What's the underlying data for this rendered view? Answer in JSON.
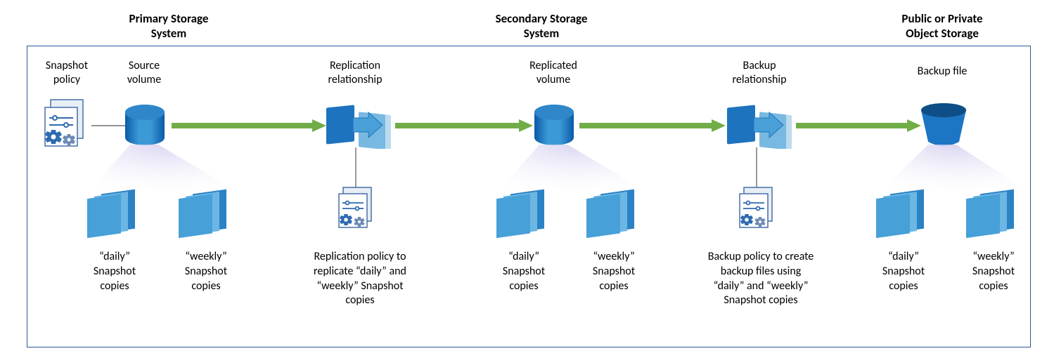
{
  "titles": {
    "primary": "Primary Storage\nSystem",
    "secondary": "Secondary Storage\nSystem",
    "object": "Public or Private\nObject Storage"
  },
  "labels": {
    "snapshot_policy": "Snapshot\npolicy",
    "source_volume": "Source\nvolume",
    "replication_relationship": "Replication\nrelationship",
    "replicated_volume": "Replicated\nvolume",
    "backup_relationship": "Backup\nrelationship",
    "backup_file": "Backup file"
  },
  "captions": {
    "daily": "“daily”\nSnapshot\ncopies",
    "weekly": "“weekly”\nSnapshot\ncopies",
    "replication_policy": "Replication policy to\nreplicate “daily” and\n“weekly” Snapshot\ncopies",
    "backup_policy": "Backup policy to create\nbackup files using\n“daily” and “weekly”\nSnapshot copies"
  }
}
